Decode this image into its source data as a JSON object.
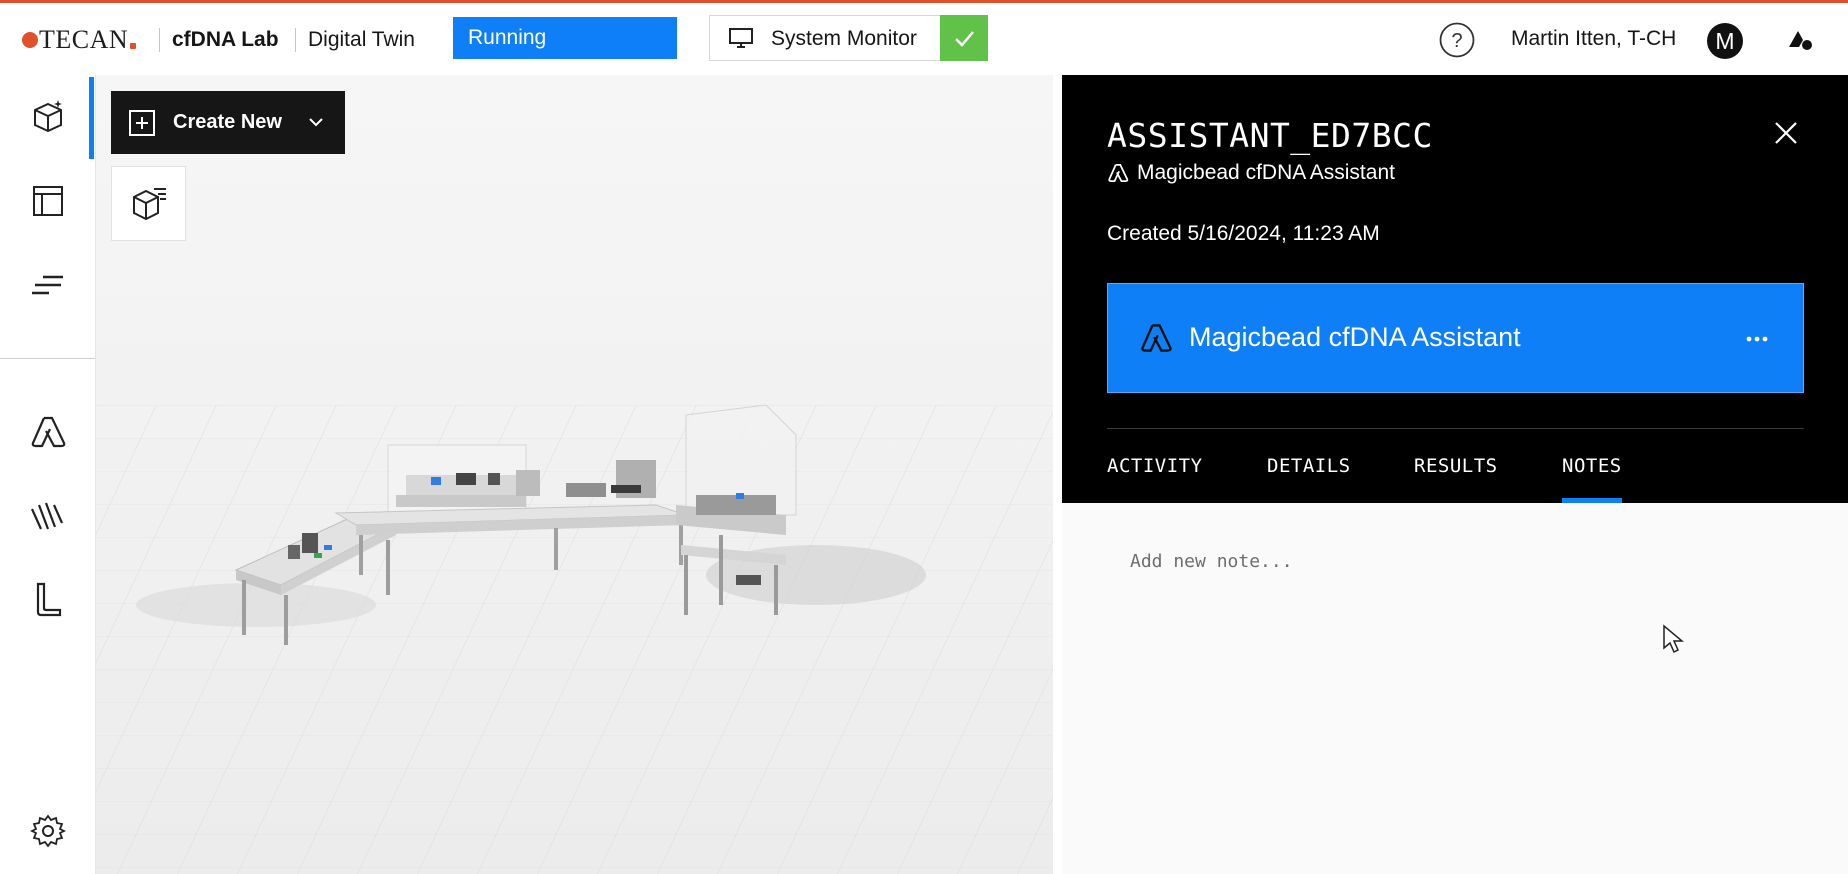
{
  "header": {
    "logo_text": "TECAN",
    "lab_name": "cfDNA Lab",
    "section": "Digital Twin",
    "status": "Running",
    "system_monitor_label": "System Monitor",
    "user_name": "Martin Itten, T-CH",
    "avatar_initial": "M"
  },
  "toolbar": {
    "create_new_label": "Create New"
  },
  "panel": {
    "title": "ASSISTANT_ED7BCC",
    "subtitle": "Magicbead cfDNA Assistant",
    "created": "Created 5/16/2024, 11:23 AM",
    "card_label": "Magicbead cfDNA Assistant",
    "tabs": [
      {
        "label": "ACTIVITY",
        "active": false
      },
      {
        "label": "DETAILS",
        "active": false
      },
      {
        "label": "RESULTS",
        "active": false
      },
      {
        "label": "NOTES",
        "active": true
      }
    ]
  },
  "notes": {
    "placeholder": "Add new note..."
  },
  "colors": {
    "accent": "#0f7ff7",
    "brand": "#e0502a",
    "success": "#61c24a"
  },
  "icons": [
    "cube-sparkle-icon",
    "layout-icon",
    "lines-icon",
    "assistant-icon",
    "wave-icon",
    "pipette-icon",
    "settings-icon",
    "help-icon",
    "monitor-icon",
    "check-icon",
    "close-icon",
    "more-icon",
    "plus-icon",
    "chevron-down-icon",
    "cube-list-icon"
  ]
}
